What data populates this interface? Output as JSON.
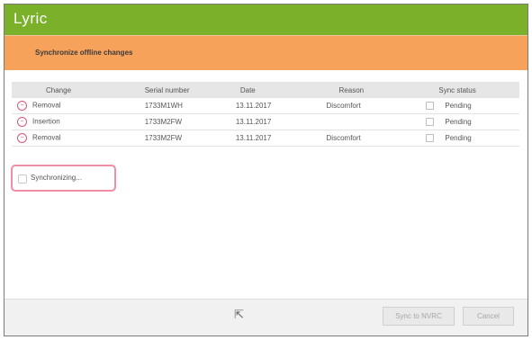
{
  "app": {
    "title": "Lyric"
  },
  "section": {
    "title": "Synchronize offline changes"
  },
  "table": {
    "columns": [
      "Change",
      "Serial number",
      "Date",
      "Reason",
      "Sync status"
    ],
    "rows": [
      {
        "change": "Removal",
        "serial": "1733M1WH",
        "date": "13.11.2017",
        "reason": "Discomfort",
        "status": "Pending"
      },
      {
        "change": "Insertion",
        "serial": "1733M2FW",
        "date": "13.11.2017",
        "reason": "",
        "status": "Pending"
      },
      {
        "change": "Removal",
        "serial": "1733M2FW",
        "date": "13.11.2017",
        "reason": "Discomfort",
        "status": "Pending"
      }
    ]
  },
  "sync": {
    "label": "Synchronizing..."
  },
  "footer": {
    "sync_button": "Sync to NVRC",
    "cancel_button": "Cancel"
  },
  "icons": {
    "row_icon": "minus-circle-icon",
    "status_icon": "pending-icon",
    "cursor": "mouse-cursor-icon"
  },
  "colors": {
    "header": "#7bb02b",
    "section": "#f6a25b",
    "highlight": "#ef8ea4"
  }
}
